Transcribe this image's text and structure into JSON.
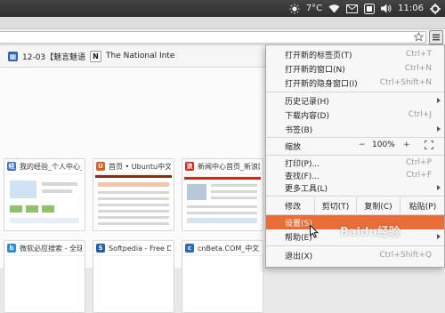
{
  "topbar": {
    "temperature": "7°C",
    "time": "11:06",
    "icons": [
      "weather-sun-icon",
      "wifi-icon",
      "mail-icon",
      "input-method-icon",
      "volume-icon",
      "settings-gear-icon"
    ]
  },
  "bookmarks": [
    {
      "icon": "calendar-favicon",
      "label": "12-03【魅言魅语"
    },
    {
      "icon": "national-interest-favicon",
      "label": "The National Inte"
    }
  ],
  "tiles": [
    {
      "title": "我的经验_个人中心_",
      "icon_color": "#3b6fc4"
    },
    {
      "title": "首页 • Ubuntu中文论",
      "icon_color": "#e0601f"
    },
    {
      "title": "新闻中心首页_新浪网",
      "icon_color": "#d8221a"
    },
    {
      "title": "微软必应搜索 - 全球",
      "icon_color": "#2b8fd6"
    },
    {
      "title": "Softpedia - Free Dow",
      "icon_color": "#1f5fa8"
    },
    {
      "title": "cnBeta.COM_中文业",
      "icon_color": "#2a6bb0"
    }
  ],
  "menu": {
    "items": [
      {
        "label": "打开新的标签页(T)",
        "shortcut": "Ctrl+T"
      },
      {
        "label": "打开新的窗口(N)",
        "shortcut": "Ctrl+N"
      },
      {
        "label": "打开新的隐身窗口(I)",
        "shortcut": "Ctrl+Shift+N"
      },
      {
        "label": "历史记录(H)",
        "shortcut": ""
      },
      {
        "label": "下载内容(D)",
        "shortcut": "Ctrl+J"
      },
      {
        "label": "书签(B)",
        "shortcut": ""
      }
    ],
    "zoom": {
      "label": "缩放",
      "minus": "−",
      "value": "100%",
      "plus": "+"
    },
    "items2": [
      {
        "label": "打印(P)...",
        "shortcut": "Ctrl+P"
      },
      {
        "label": "查找(F)...",
        "shortcut": "Ctrl+F"
      },
      {
        "label": "更多工具(L)",
        "shortcut": ""
      }
    ],
    "edit": {
      "label": "修改",
      "cut": "剪切(T)",
      "copy": "复制(C)",
      "paste": "粘贴(P)"
    },
    "settings": {
      "label": "设置(S)"
    },
    "help": {
      "label": "帮助(E)"
    },
    "exit": {
      "label": "退出(X)",
      "shortcut": "Ctrl+Shift+Q"
    }
  },
  "watermark": "Baidu经验",
  "colors": {
    "highlight": "#e96d38",
    "panel": "#3a3a3a"
  }
}
